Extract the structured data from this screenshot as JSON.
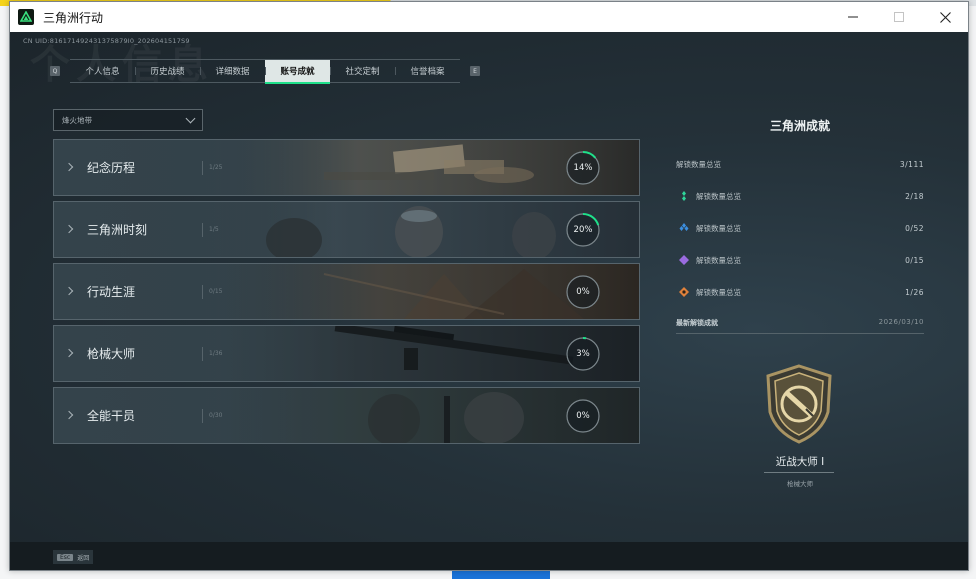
{
  "window": {
    "title": "三角洲行动"
  },
  "header": {
    "uid": "CN UID:816171492431375879I0_2026041517S9",
    "ghost_text": "个人信息"
  },
  "tabs": [
    {
      "label": "个人信息",
      "active": false
    },
    {
      "label": "历史战绩",
      "active": false
    },
    {
      "label": "详细数据",
      "active": false
    },
    {
      "label": "账号成就",
      "active": true
    },
    {
      "label": "社交定制",
      "active": false
    },
    {
      "label": "信誉档案",
      "active": false
    }
  ],
  "tab_keys": {
    "prev": "Q",
    "next": "E"
  },
  "filter": {
    "value": "烽火地带"
  },
  "categories": [
    {
      "label": "纪念历程",
      "sub": "1/25",
      "percent": 14,
      "progress": 0.14
    },
    {
      "label": "三角洲时刻",
      "sub": "1/5",
      "percent": 20,
      "progress": 0.2
    },
    {
      "label": "行动生涯",
      "sub": "0/15",
      "percent": 0,
      "progress": 0.0
    },
    {
      "label": "枪械大师",
      "sub": "1/36",
      "percent": 3,
      "progress": 0.03
    },
    {
      "label": "全能干员",
      "sub": "0/30",
      "percent": 0,
      "progress": 0.0
    }
  ],
  "summary": {
    "title": "三角洲成就",
    "total": {
      "label": "解锁数量总览",
      "value": "3/111"
    },
    "rows": [
      {
        "label": "解锁数量总览",
        "value": "2/18",
        "color": "#2fd59a"
      },
      {
        "label": "解锁数量总览",
        "value": "0/52",
        "color": "#3b8fe0"
      },
      {
        "label": "解锁数量总览",
        "value": "0/15",
        "color": "#9a6be0"
      },
      {
        "label": "解锁数量总览",
        "value": "1/26",
        "color": "#e0813b"
      }
    ],
    "latest_label": "最新解锁成就",
    "latest_date": "2026/03/10",
    "badge_name": "近战大师 I",
    "badge_sub": "枪械大师"
  },
  "footer": {
    "esc_key": "Esc",
    "esc_label": "返回"
  },
  "colors": {
    "accent": "#1fe08a",
    "tab_active_bg": "#dfe7e6"
  }
}
